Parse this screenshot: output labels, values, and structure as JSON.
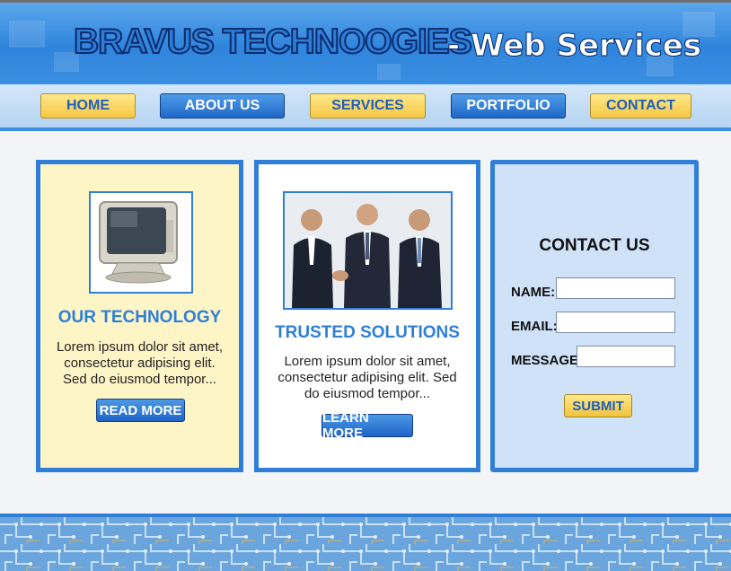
{
  "header": {
    "brand": "BRAVUS TECHNOOGIES",
    "tagline": "- Web Services"
  },
  "nav": {
    "items": [
      {
        "label": "HOME",
        "style": "yellow"
      },
      {
        "label": "ABOUT US",
        "style": "blue"
      },
      {
        "label": "SERVICES",
        "style": "yellow"
      },
      {
        "label": "PORTFOLIO",
        "style": "blue"
      },
      {
        "label": "CONTACT",
        "style": "yellow"
      }
    ]
  },
  "cards": [
    {
      "title": "OUR TECHNOLOGY",
      "text": "Lorem ipsum dolor sit amet, consectetur adipising elit. Sed do eiusmod tempor...",
      "button": "READ MORE",
      "image": "crt-monitor-icon"
    },
    {
      "title": "TRUSTED SOLUTIONS",
      "text": "Lorem ipsum dolor sit amet, consectetur adipising elit. Sed do eiusmod tempor...",
      "button": "LEARN MORE",
      "image": "business-team-photo"
    }
  ],
  "contact": {
    "title": "CONTACT US",
    "name_label": "NAME:",
    "email_label": "EMAIL:",
    "message_label": "MESSAGE:",
    "submit": "SUBMIT"
  },
  "colors": {
    "brand_blue": "#2f7fd8",
    "nav_yellow": "#f5c844",
    "card1_bg": "#fef5c7",
    "contact_bg": "#cfe2f8"
  }
}
